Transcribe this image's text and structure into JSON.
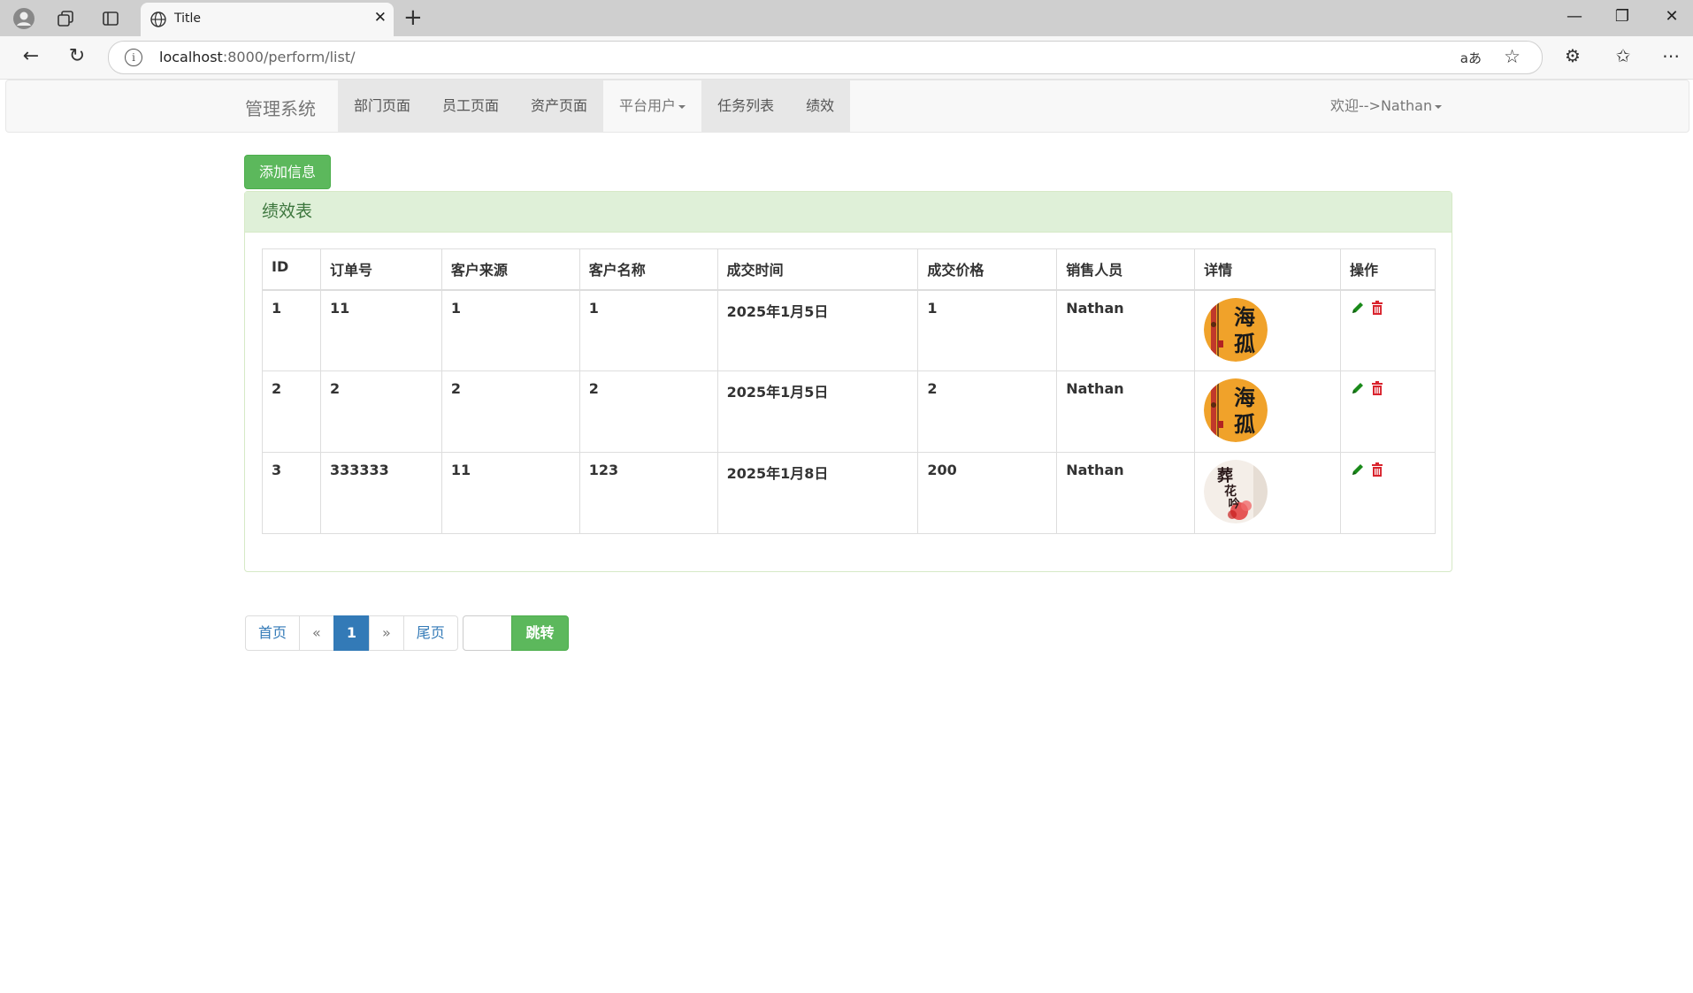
{
  "browser": {
    "tab_title": "Title",
    "url_host": "localhost",
    "url_path": ":8000/perform/list/",
    "reader_label": "aあ"
  },
  "navbar": {
    "brand": "管理系统",
    "items": [
      "部门页面",
      "员工页面",
      "资产页面",
      "平台用户",
      "任务列表",
      "绩效"
    ],
    "welcome": "欢迎-->Nathan"
  },
  "add_button": "添加信息",
  "panel": {
    "title": "绩效表",
    "columns": [
      "ID",
      "订单号",
      "客户来源",
      "客户名称",
      "成交时间",
      "成交价格",
      "销售人员",
      "详情",
      "操作"
    ],
    "rows": [
      {
        "id": "1",
        "order_no": "11",
        "source": "1",
        "customer": "1",
        "deal_time": "2025年1月5日",
        "price": "1",
        "sales": "Nathan",
        "avatar_text": "海孤"
      },
      {
        "id": "2",
        "order_no": "2",
        "source": "2",
        "customer": "2",
        "deal_time": "2025年1月5日",
        "price": "2",
        "sales": "Nathan",
        "avatar_text": "海孤"
      },
      {
        "id": "3",
        "order_no": "333333",
        "source": "11",
        "customer": "123",
        "deal_time": "2025年1月8日",
        "price": "200",
        "sales": "Nathan",
        "avatar_text": "葬花吟"
      }
    ]
  },
  "pagination": {
    "first": "首页",
    "prev": "«",
    "current": "1",
    "next": "»",
    "last": "尾页",
    "jump": "跳转"
  },
  "colors": {
    "success": "#5cb85c",
    "panel_heading_bg": "#dff0d8",
    "panel_heading_text": "#3c763d",
    "link": "#337ab7",
    "edit_icon": "#1a8a1a",
    "delete_icon": "#d9232d"
  }
}
